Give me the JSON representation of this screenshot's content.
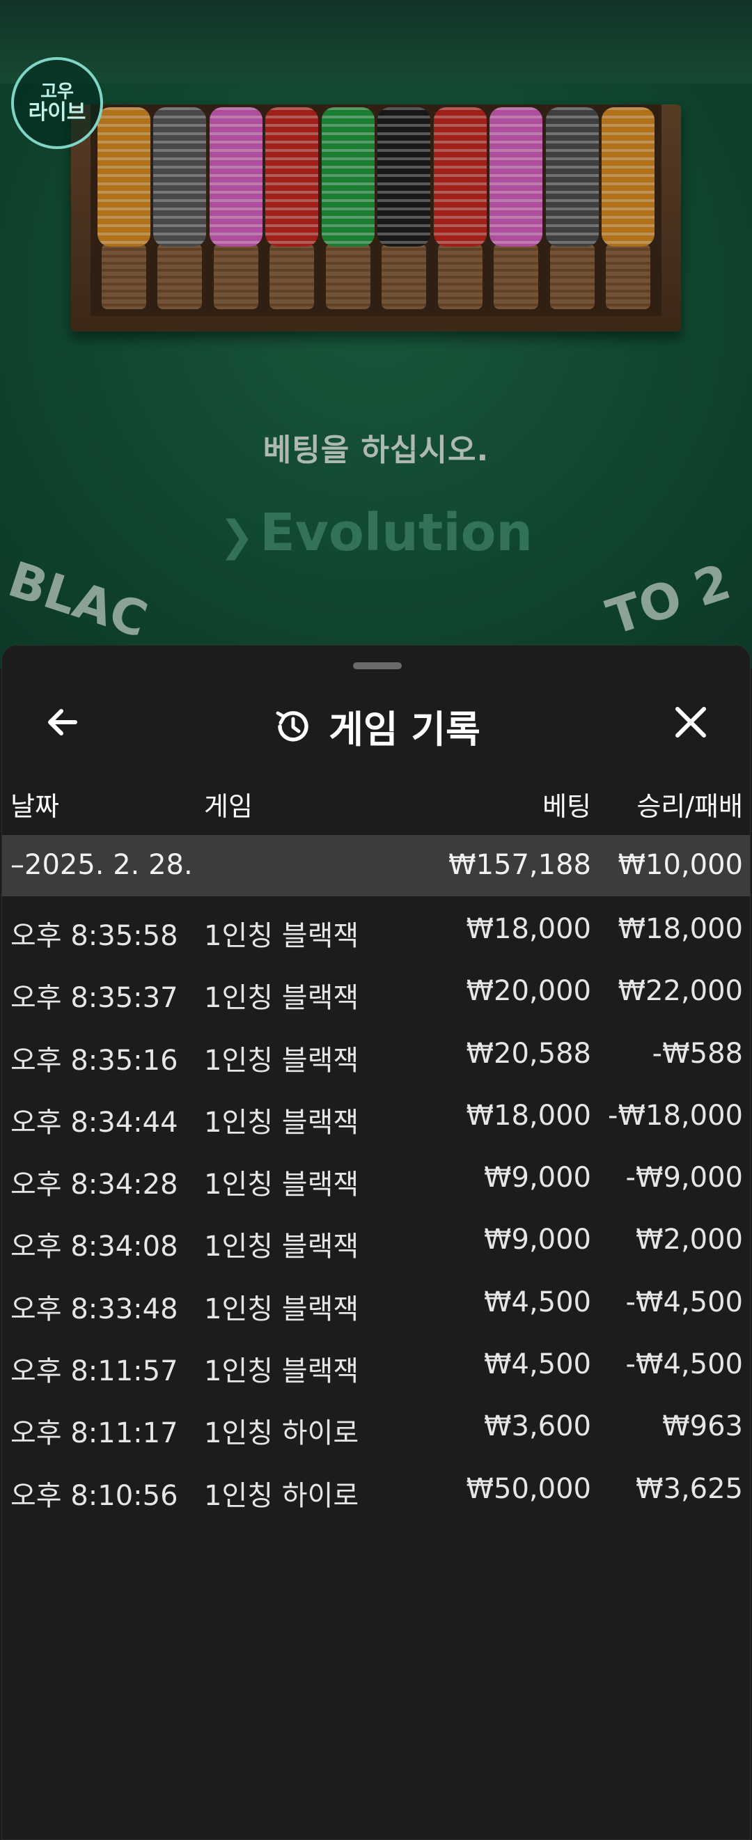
{
  "background": {
    "logo": {
      "line1": "고우",
      "line2": "라이브"
    },
    "message": "베팅을 하십시오.",
    "brand": "Evolution",
    "table_text_left": "BLAC",
    "table_text_right": "TO 2",
    "chip_colors": [
      "#d88a1e",
      "#5a5a5a",
      "#d65fbf",
      "#c4271f",
      "#1f9a3a",
      "#1e1e1e",
      "#c4271f",
      "#d65fbf",
      "#4d4d4d",
      "#d88a1e"
    ]
  },
  "sheet": {
    "title": "게임 기록",
    "back_icon": "arrow-left-icon",
    "history_icon": "history-icon",
    "close_icon": "close-icon"
  },
  "columns": {
    "date": "날짜",
    "game": "게임",
    "bet": "베팅",
    "win_loss": "승리/패배"
  },
  "summary": {
    "date": "–2025. 2. 28.",
    "bet": "₩157,188",
    "win_loss": "₩10,000"
  },
  "rows": [
    {
      "time": "오후 8:35:58",
      "game": "1인칭 블랙잭",
      "bet": "₩18,000",
      "win_loss": "₩18,000"
    },
    {
      "time": "오후 8:35:37",
      "game": "1인칭 블랙잭",
      "bet": "₩20,000",
      "win_loss": "₩22,000"
    },
    {
      "time": "오후 8:35:16",
      "game": "1인칭 블랙잭",
      "bet": "₩20,588",
      "win_loss": "-₩588"
    },
    {
      "time": "오후 8:34:44",
      "game": "1인칭 블랙잭",
      "bet": "₩18,000",
      "win_loss": "-₩18,000"
    },
    {
      "time": "오후 8:34:28",
      "game": "1인칭 블랙잭",
      "bet": "₩9,000",
      "win_loss": "-₩9,000"
    },
    {
      "time": "오후 8:34:08",
      "game": "1인칭 블랙잭",
      "bet": "₩9,000",
      "win_loss": "₩2,000"
    },
    {
      "time": "오후 8:33:48",
      "game": "1인칭 블랙잭",
      "bet": "₩4,500",
      "win_loss": "-₩4,500"
    },
    {
      "time": "오후 8:11:57",
      "game": "1인칭 블랙잭",
      "bet": "₩4,500",
      "win_loss": "-₩4,500"
    },
    {
      "time": "오후 8:11:17",
      "game": "1인칭 하이로",
      "bet": "₩3,600",
      "win_loss": "₩963"
    },
    {
      "time": "오후 8:10:56",
      "game": "1인칭 하이로",
      "bet": "₩50,000",
      "win_loss": "₩3,625"
    }
  ]
}
